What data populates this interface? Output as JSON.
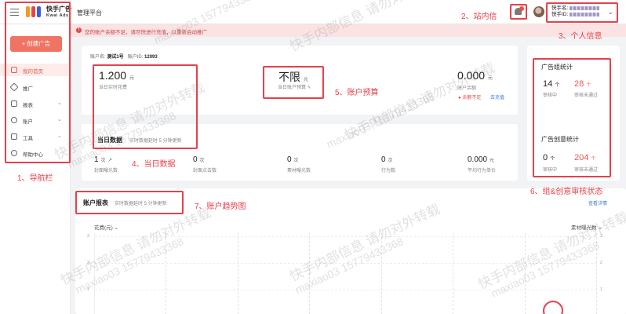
{
  "topbar": {
    "logo_text": "快手广告",
    "logo_sub": "Kwai Ads",
    "platform_title": "管理平台",
    "account_line1_prefix": "快手名:",
    "account_line2_prefix": "快手ID:"
  },
  "alert": {
    "icon": "!",
    "text": "您的账户余额不足，请尽快进行充值，以重新启动推广"
  },
  "sidebar": {
    "create_button": "+ 创建广告",
    "items": [
      {
        "label": "我的首页",
        "icon": "home-icon",
        "active": true
      },
      {
        "label": "推广",
        "icon": "layers-icon"
      },
      {
        "label": "报表",
        "icon": "chart-icon",
        "chevron": "⌄"
      },
      {
        "label": "账户",
        "icon": "user-icon",
        "chevron": "⌄"
      },
      {
        "label": "工具",
        "icon": "briefcase-icon",
        "chevron": "⌄"
      },
      {
        "label": "帮助中心",
        "icon": "help-icon"
      }
    ]
  },
  "account": {
    "name_label": "账户名:",
    "name": "测试1号",
    "id_label": "账户ID:",
    "id": "12093",
    "spend_value": "1.200",
    "spend_unit": "元",
    "spend_label": "当日实时花费",
    "budget_value": "不限",
    "budget_unit": "元",
    "budget_label": "当日账户预算",
    "balance_value": "0.000",
    "balance_unit": "元",
    "balance_label": "账户余额",
    "balance_warning": "余额不足",
    "recharge_link": "去充值"
  },
  "today": {
    "title": "当日数据",
    "note": "实时数据延时 5 分钟更新",
    "metrics": [
      {
        "value": "1",
        "unit": "次",
        "label": "封面曝光数",
        "trend": true
      },
      {
        "value": "0",
        "unit": "次",
        "label": "封面点击数"
      },
      {
        "value": "0",
        "unit": "次",
        "label": "素材曝光数"
      },
      {
        "value": "0",
        "unit": "次",
        "label": "行为数"
      },
      {
        "value": "0.000",
        "unit": "元",
        "label": "平均行为单价"
      }
    ]
  },
  "stats": {
    "group_title": "广告组统计",
    "group_reviewing_value": "14",
    "group_reviewing_unit": "个",
    "group_reviewing_label": "审核中",
    "group_rejected_value": "28",
    "group_rejected_unit": "个",
    "group_rejected_label": "审核未通过",
    "creative_title": "广告创意统计",
    "creative_reviewing_value": "0",
    "creative_reviewing_unit": "个",
    "creative_reviewing_label": "审核中",
    "creative_rejected_value": "204",
    "creative_rejected_unit": "个",
    "creative_rejected_label": "审核未通过"
  },
  "report": {
    "title": "账户报表",
    "note": "实时数据延时 5 分钟更新",
    "view_detail": "查看详情",
    "left_metric": "花费(元)",
    "right_metric": "素材曝光数",
    "chevron": "⌄",
    "y_ticks": [
      "3",
      "2",
      "1"
    ]
  },
  "annotations": {
    "nav": "1、导航栏",
    "messages": "2、站内信",
    "profile": "3、个人信息",
    "today": "4、当日数据",
    "budget": "5、账户预算",
    "review": "6、组&创意审核状态",
    "trend": "7、账户趋势图"
  },
  "watermark": {
    "line1": "快手内部信息 请勿对外转载",
    "line2": "maxiao03 15779433368"
  },
  "colors": {
    "accent": "#e85a4f",
    "annotation": "#e7414b",
    "rejected": "#e85a4f",
    "link": "#3a7bd5",
    "alert_bg": "#fbe3e4"
  }
}
